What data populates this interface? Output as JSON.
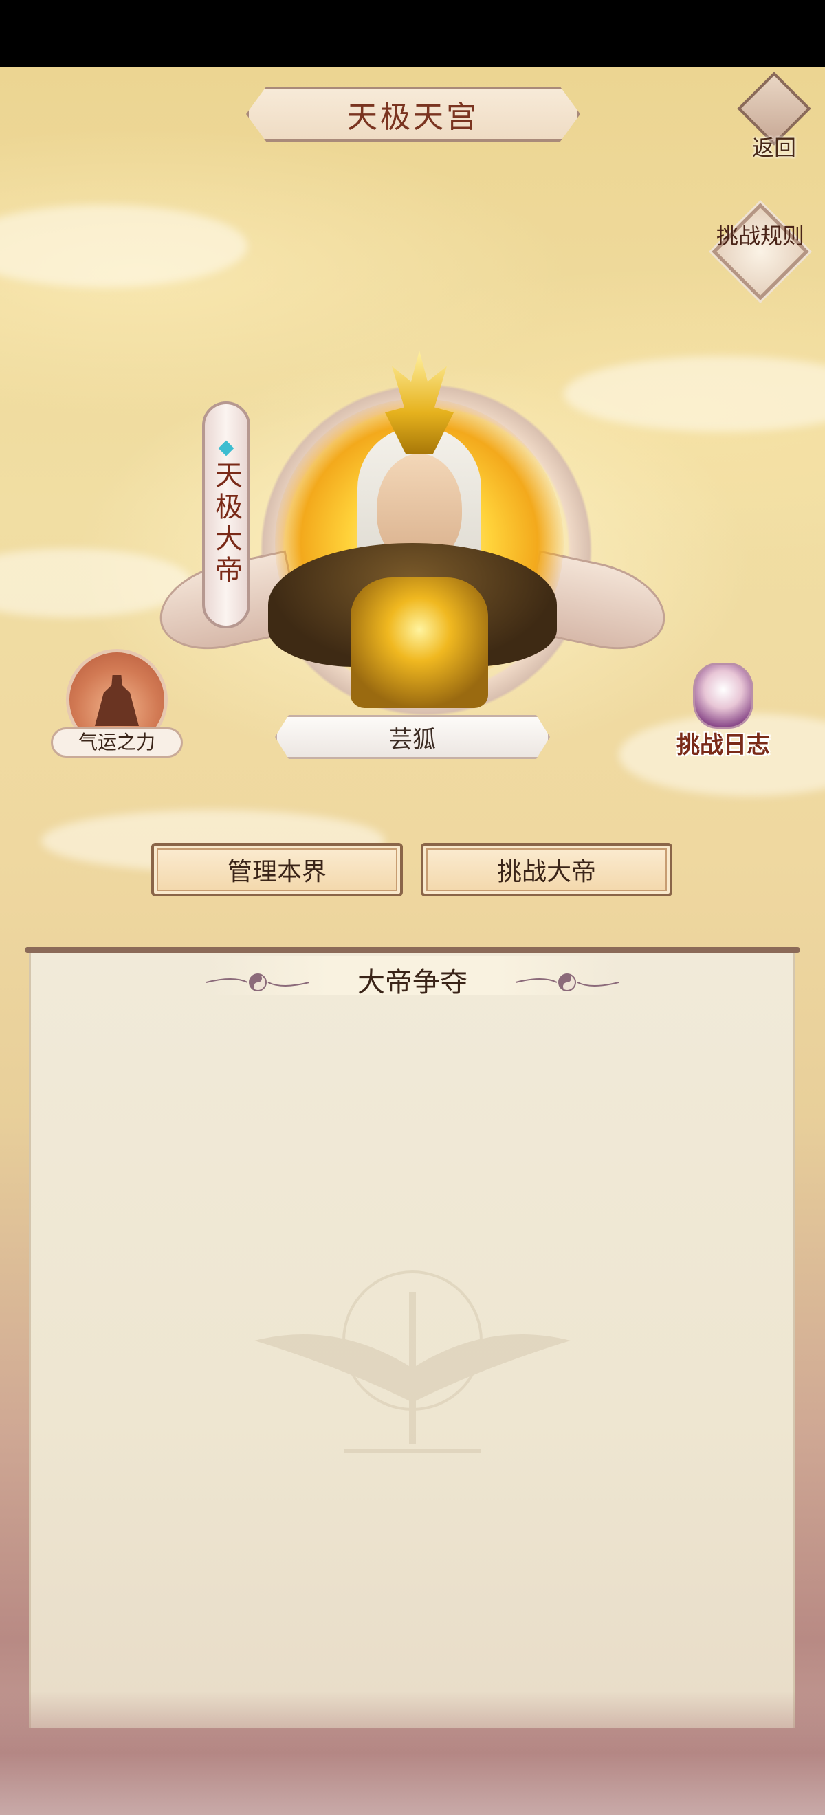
{
  "header": {
    "title": "天极天宫",
    "back_label": "返回",
    "rules_label": "挑战规则"
  },
  "emperor": {
    "title_banner": "天极大帝",
    "player_name": "芸狐"
  },
  "side_buttons": {
    "fortune_label": "气运之力",
    "log_label": "挑战日志"
  },
  "actions": {
    "manage_label": "管理本界",
    "challenge_label": "挑战大帝"
  },
  "panel": {
    "title": "大帝争夺"
  },
  "colors": {
    "title_text": "#7a3420",
    "button_border": "#8a6548",
    "panel_bg": "#f1ead9"
  }
}
